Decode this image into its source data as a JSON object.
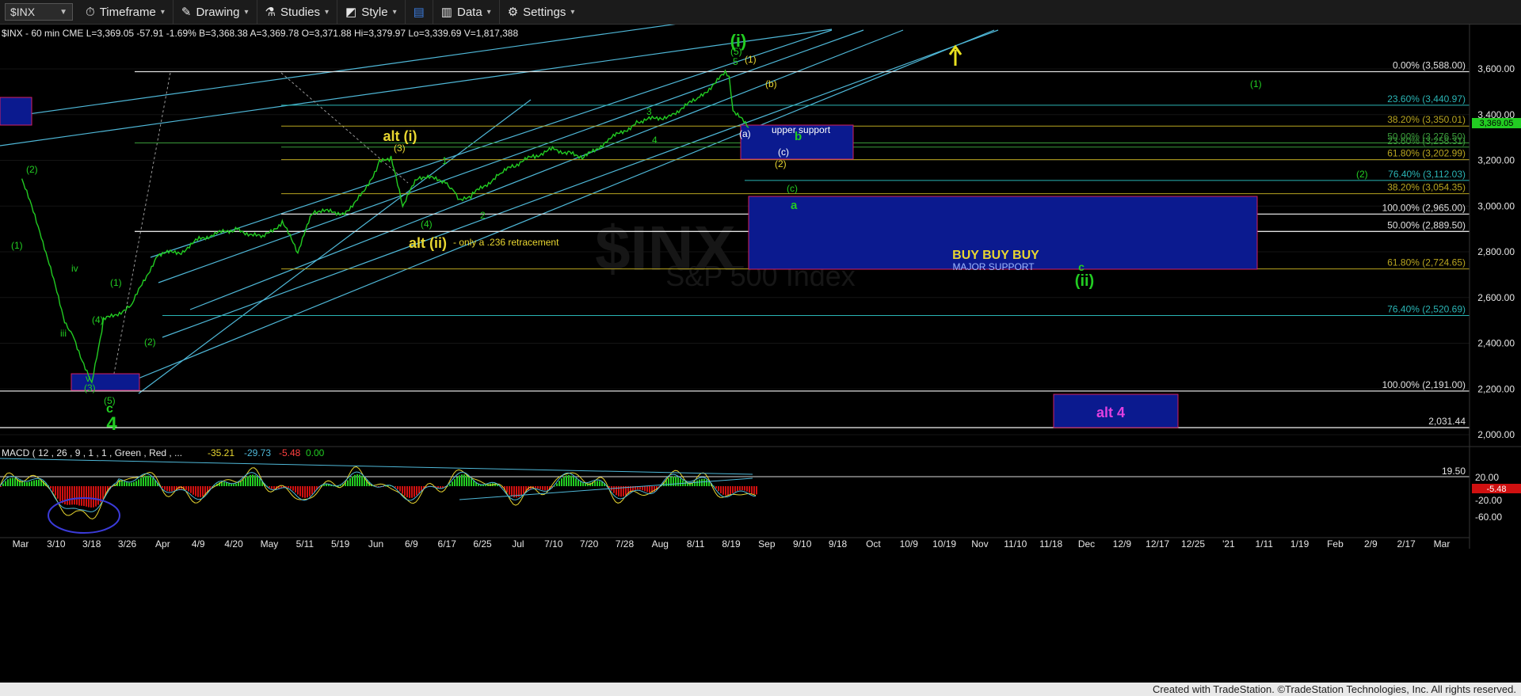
{
  "toolbar": {
    "symbol": "$INX",
    "timeframe": "Timeframe",
    "drawing": "Drawing",
    "studies": "Studies",
    "style": "Style",
    "data": "Data",
    "settings": "Settings"
  },
  "header_line": "$INX - 60 min  CME  L=3,369.05  -57.91  -1.69%  B=3,368.38  A=3,369.78  O=3,371.88  Hi=3,379.97  Lo=3,339.69  V=1,817,388",
  "watermark": {
    "line1": "$INX",
    "line2": "S&P 500 Index"
  },
  "colors": {
    "price": "#22cc22",
    "background": "#000000",
    "box_fill": "#0b1a8f",
    "box_border": "#d42060",
    "fib_cyan": "#2ab5b5",
    "fib_yellow": "#b8a520",
    "fib_white": "#e0e0e0",
    "last_price_bg": "#22cc22",
    "macd_neg": "#d01010"
  },
  "chart_data": {
    "type": "line",
    "title": "$INX - 60 min",
    "series": [
      {
        "name": "$INX",
        "x": [
          "3/5",
          "3/10",
          "3/16",
          "3/18",
          "3/23",
          "3/26",
          "4/2",
          "4/9",
          "4/15",
          "4/20",
          "4/29",
          "5/6",
          "5/11",
          "5/15",
          "5/19",
          "5/27",
          "6/1",
          "6/5",
          "6/8",
          "6/11",
          "6/15",
          "6/22",
          "6/24",
          "6/26",
          "6/29",
          "7/6",
          "7/10",
          "7/15",
          "7/20",
          "7/24",
          "7/28",
          "8/3",
          "8/11",
          "8/17",
          "8/19",
          "8/26",
          "9/2",
          "9/3",
          "9/4",
          "9/8"
        ],
        "y": [
          3120,
          2870,
          2500,
          2440,
          2220,
          2500,
          2560,
          2790,
          2800,
          2860,
          2900,
          2860,
          2930,
          2800,
          2980,
          2970,
          3060,
          3190,
          3210,
          3000,
          3130,
          3110,
          3070,
          3020,
          3050,
          3140,
          3180,
          3220,
          3250,
          3230,
          3215,
          3290,
          3370,
          3390,
          3400,
          3470,
          3580,
          3560,
          3420,
          3343
        ]
      }
    ],
    "y_axis": {
      "labels": [
        "3,600.00",
        "3,400.00",
        "3,200.00",
        "3,000.00",
        "2,800.00",
        "2,600.00",
        "2,400.00",
        "2,200.00",
        "2,000.00"
      ],
      "range": [
        1910,
        3700
      ]
    },
    "x_axis_labels": [
      "Mar",
      "3/10",
      "3/18",
      "3/26",
      "Apr",
      "4/9",
      "4/20",
      "May",
      "5/11",
      "5/19",
      "Jun",
      "6/9",
      "6/17",
      "6/25",
      "Jul",
      "7/10",
      "7/20",
      "7/28",
      "Aug",
      "8/11",
      "8/19",
      "Sep",
      "9/10",
      "9/18",
      "Oct",
      "10/9",
      "10/19",
      "Nov",
      "11/10",
      "11/18",
      "Dec",
      "12/9",
      "12/17",
      "12/25",
      "'21",
      "1/11",
      "1/19",
      "Feb",
      "2/9",
      "2/17",
      "Mar"
    ],
    "fib_levels": [
      {
        "label": "0.00% (3,588.00)",
        "value": 3588,
        "color": "white"
      },
      {
        "label": "23.60% (3,440.97)",
        "value": 3441,
        "color": "cyan"
      },
      {
        "label": "38.20% (3,350.01)",
        "value": 3350,
        "color": "yellow"
      },
      {
        "label": "50.00% (3,276.50)",
        "value": 3276,
        "color": "green"
      },
      {
        "label": "23.60% (3,258.31)",
        "value": 3258,
        "color": "green"
      },
      {
        "label": "61.80% (3,202.99)",
        "value": 3203,
        "color": "yellow"
      },
      {
        "label": "76.40% (3,112.03)",
        "value": 3112,
        "color": "cyan"
      },
      {
        "label": "38.20% (3,054.35)",
        "value": 3054,
        "color": "yellow"
      },
      {
        "label": "100.00% (2,965.00)",
        "value": 2965,
        "color": "white"
      },
      {
        "label": "50.00% (2,889.50)",
        "value": 2889,
        "color": "white"
      },
      {
        "label": "61.80% (2,724.65)",
        "value": 2725,
        "color": "yellow"
      },
      {
        "label": "76.40% (2,520.69)",
        "value": 2521,
        "color": "cyan"
      },
      {
        "label": "100.00% (2,191.00)",
        "value": 2191,
        "color": "white"
      },
      {
        "label": "2,031.44",
        "value": 2031,
        "color": "white"
      }
    ],
    "last_price": "3,369.05",
    "annotations": [
      {
        "text": "(i)",
        "color": "green"
      },
      {
        "text": "alt (i)",
        "color": "yellow"
      },
      {
        "text": "alt (ii)",
        "color": "yellow"
      },
      {
        "text": "- only a .236 retracement",
        "color": "yellow"
      },
      {
        "text": "upper support",
        "color": "white"
      },
      {
        "text": "BUY BUY BUY",
        "color": "yellow"
      },
      {
        "text": "MAJOR SUPPORT",
        "color": "lightblue"
      },
      {
        "text": "alt 4",
        "color": "magenta"
      },
      {
        "text": "(ii)",
        "color": "green"
      },
      {
        "text": "4",
        "color": "green"
      },
      {
        "text": "c",
        "color": "green"
      }
    ],
    "macd": {
      "label": "MACD ( 12 , 26 , 9 , 1 , 1 , Green , Red , ...",
      "values": [
        "-35.21",
        "-29.73",
        "-5.48",
        "0.00"
      ],
      "axis_labels": [
        "20.00",
        "-20.00",
        "-60.00"
      ],
      "right_values": [
        "19.50",
        "-5.48"
      ]
    }
  },
  "footer": "Created with TradeStation. ©TradeStation Technologies, Inc. All rights reserved."
}
